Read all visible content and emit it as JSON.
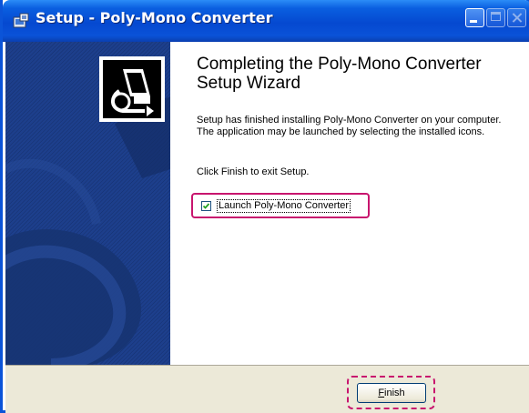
{
  "window": {
    "title": "Setup - Poly-Mono Converter",
    "title_icon": "setup-icon",
    "controls": [
      "minimize-icon",
      "maximize-icon",
      "close-icon"
    ]
  },
  "sidebar": {
    "logo_icon": "installer-computer-icon",
    "background_color": "#1b3c86"
  },
  "main": {
    "heading": "Completing the Poly-Mono Converter Setup Wizard",
    "message": "Setup has finished installing Poly-Mono Converter on your computer. The application may be launched by selecting the installed icons.",
    "instruction": "Click Finish to exit Setup.",
    "launch_checkbox": {
      "label": "Launch Poly-Mono Converter",
      "checked": true
    }
  },
  "footer": {
    "finish_label_accel": "F",
    "finish_label_rest": "inish"
  },
  "colors": {
    "titlebar": "#0549d0",
    "highlight": "#c8156e",
    "checkbox_check": "#21a121"
  }
}
